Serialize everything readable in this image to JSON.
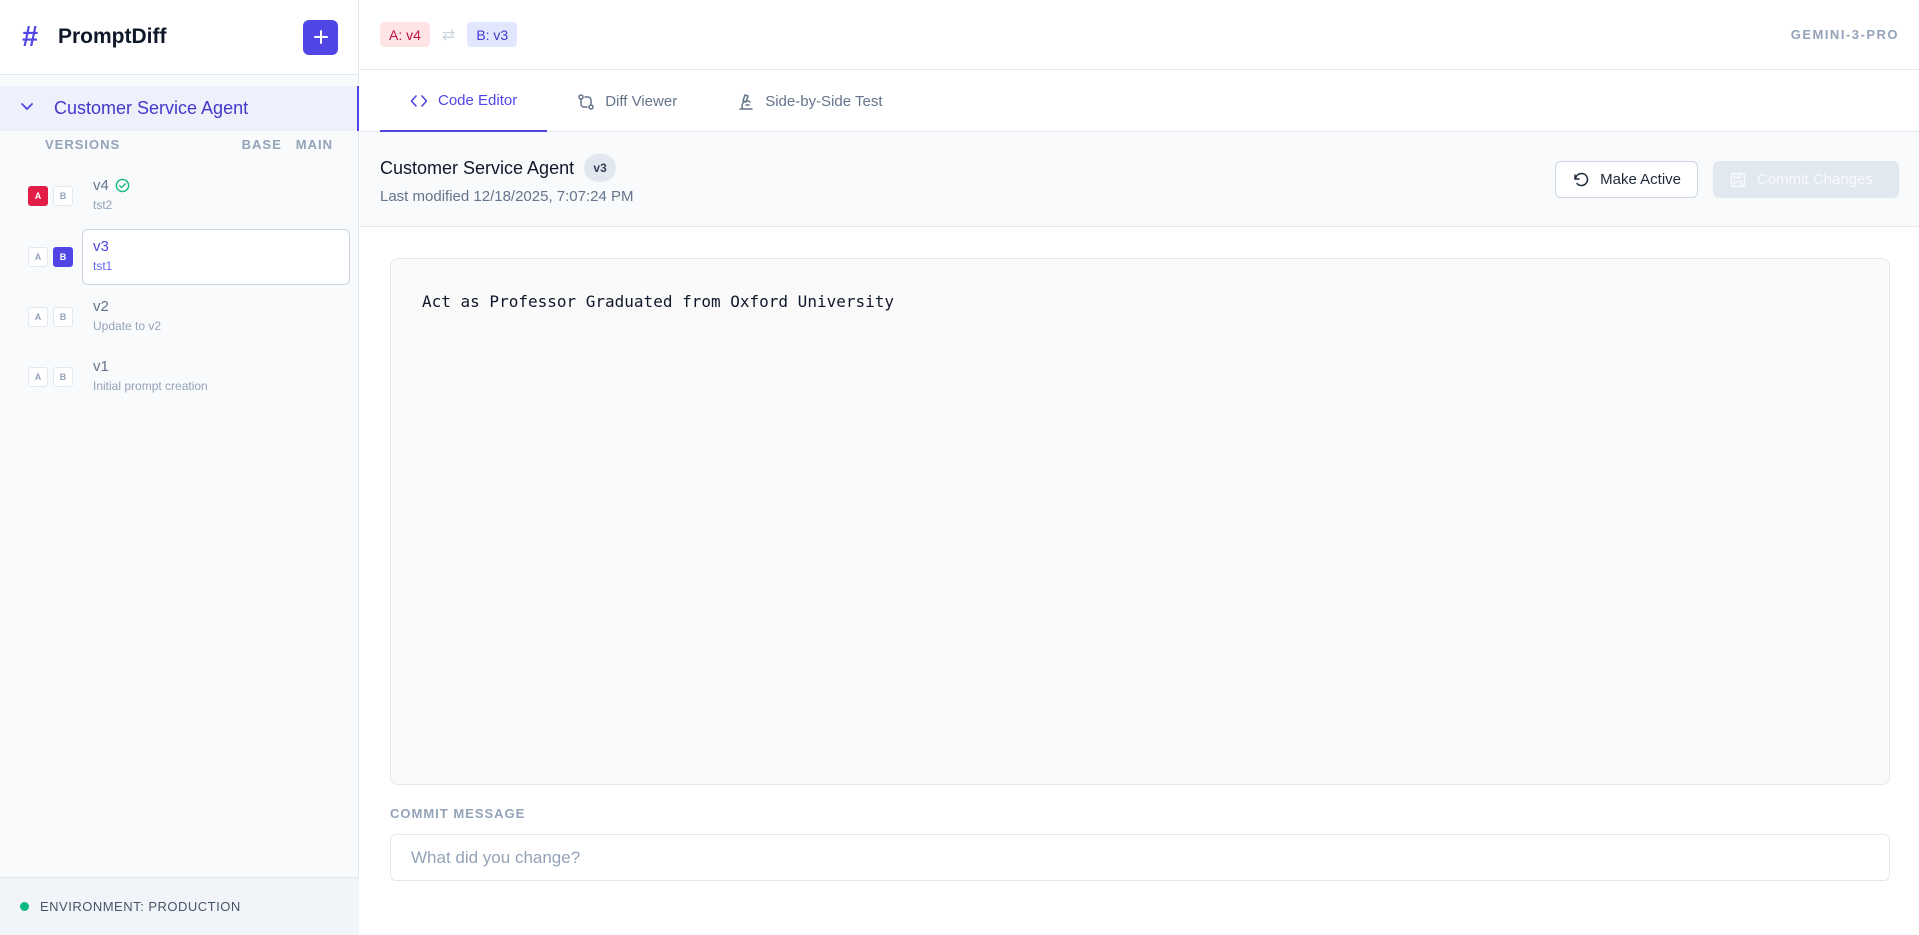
{
  "app": {
    "name": "PromptDiff",
    "add_icon": "plus-icon"
  },
  "sidebar": {
    "project": "Customer Service Agent",
    "versions_header": "VERSIONS",
    "base_header": "BASE",
    "main_header": "MAIN",
    "versions": [
      {
        "label": "v4",
        "message": "tst2",
        "a": "A",
        "b": "B",
        "a_selected": true,
        "b_selected": false,
        "active": true
      },
      {
        "label": "v3",
        "message": "tst1",
        "a": "A",
        "b": "B",
        "a_selected": false,
        "b_selected": true,
        "active": false
      },
      {
        "label": "v2",
        "message": "Update to v2",
        "a": "A",
        "b": "B",
        "a_selected": false,
        "b_selected": false,
        "active": false
      },
      {
        "label": "v1",
        "message": "Initial prompt creation",
        "a": "A",
        "b": "B",
        "a_selected": false,
        "b_selected": false,
        "active": false
      }
    ],
    "environment": "ENVIRONMENT: PRODUCTION",
    "env_color": "#10b981"
  },
  "topbar": {
    "chip_a": "A: v4",
    "chip_b": "B: v3",
    "swap_icon": "swap-arrows-icon",
    "model": "GEMINI-3-PRO"
  },
  "tabs": [
    {
      "label": "Code Editor",
      "icon": "code-icon",
      "active": true
    },
    {
      "label": "Diff Viewer",
      "icon": "git-compare-icon",
      "active": false
    },
    {
      "label": "Side-by-Side Test",
      "icon": "microscope-icon",
      "active": false
    }
  ],
  "header": {
    "title": "Customer Service Agent",
    "version_badge": "v3",
    "modified": "Last modified 12/18/2025, 7:07:24 PM",
    "make_active": "Make Active",
    "commit_changes": "Commit Changes"
  },
  "editor": {
    "content": "Act as Professor Graduated from Oxford University"
  },
  "commit": {
    "label": "COMMIT MESSAGE",
    "placeholder": "What did you change?"
  },
  "colors": {
    "accent": "#4f46e5",
    "a_accent": "#e11d48",
    "success": "#10b981"
  }
}
